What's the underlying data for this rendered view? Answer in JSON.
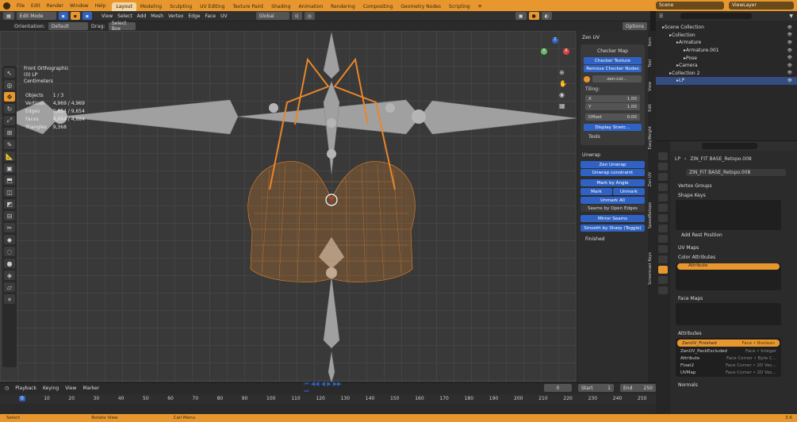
{
  "topbar": {
    "menu": [
      "File",
      "Edit",
      "Render",
      "Window",
      "Help"
    ],
    "workspaces": [
      "Layout",
      "Modeling",
      "Sculpting",
      "UV Editing",
      "Texture Paint",
      "Shading",
      "Animation",
      "Rendering",
      "Compositing",
      "Geometry Nodes",
      "Scripting"
    ],
    "active_workspace": "Layout",
    "scene": "Scene",
    "view_layer": "ViewLayer"
  },
  "viewport_header": {
    "mode": "Edit Mode",
    "menus": [
      "View",
      "Select",
      "Add",
      "Mesh",
      "Vertex",
      "Edge",
      "Face",
      "UV"
    ],
    "transform": "Global",
    "options": "Options",
    "orientation_label": "Orientation:",
    "orientation": "Default",
    "drag_label": "Drag:",
    "drag": "Select Box"
  },
  "viewport_info": {
    "view": "Front Orthographic",
    "object": "(0) LP",
    "units": "Centimeters",
    "stats": [
      [
        "Objects",
        "1 / 3"
      ],
      [
        "Vertices",
        "4,969 / 4,969"
      ],
      [
        "Edges",
        "9,654 / 9,654"
      ],
      [
        "Faces",
        "4,684 / 4,684"
      ],
      [
        "Triangles",
        "9,368"
      ]
    ]
  },
  "gizmo": {
    "x": "X",
    "y": "Y",
    "z": "Z"
  },
  "npanel": {
    "title": "Zen UV",
    "checker_map": "Checker Map",
    "checker_texture": "Checker Texture",
    "remove_checker": "Remove Checker Nodes",
    "texture_name": "zen-col...",
    "tiling": "Tiling:",
    "x_label": "X",
    "x_val": "1.00",
    "y_label": "Y",
    "y_val": "1.00",
    "offset_label": "Offset",
    "offset_val": "0.00",
    "display_stretch": "Display Stretc...",
    "tools": "Tools",
    "unwrap": "Unwrap",
    "zen_unwrap": "Zen Unwrap",
    "unwrap_constraint": "Unwrap constraint",
    "mark_by_angle": "Mark by Angle",
    "mark": "Mark",
    "unmark": "Unmark",
    "unmark_all": "Unmark All",
    "seams_by_open_edges": "Seams by Open Edges",
    "mirror_seams": "Mirror Seams",
    "smooth_by_sharp": "Smooth by Sharp (Toggle)",
    "finished": "Finished"
  },
  "side_tabs": [
    "Item",
    "Tool",
    "View",
    "Edit",
    "EasyWeight",
    "Zen UV",
    "SpeedRetopo",
    "Screencast Keys"
  ],
  "outliner": {
    "items": [
      {
        "name": "Scene Collection",
        "indent": 0
      },
      {
        "name": "Collection",
        "indent": 1
      },
      {
        "name": "Armature",
        "indent": 2
      },
      {
        "name": "Armature.001",
        "indent": 3
      },
      {
        "name": "Pose",
        "indent": 3
      },
      {
        "name": "Camera",
        "indent": 2
      },
      {
        "name": "Collection 2",
        "indent": 1
      },
      {
        "name": "LP",
        "indent": 2
      }
    ]
  },
  "properties": {
    "breadcrumb_obj": "LP",
    "breadcrumb_mesh": "ZIN_FIT BASE_Retopo.008",
    "mesh_name": "ZIN_FIT BASE_Retopo.008",
    "vertex_groups": "Vertex Groups",
    "shape_keys": "Shape Keys",
    "add_rest_position": "Add Rest Position",
    "uv_maps": "UV Maps",
    "color_attributes": "Color Attributes",
    "color_attr_item": "Attribute",
    "face_maps": "Face Maps",
    "attributes": "Attributes",
    "attr_rows": [
      [
        "ZenUV_Finished",
        "Face • Boolean"
      ],
      [
        "ZenUV_PackExcluded",
        "Face • Integer"
      ],
      [
        "Attribute",
        "Face Corner • Byte C..."
      ],
      [
        "Float2",
        "Face Corner • 2D Vec..."
      ],
      [
        "UVMap",
        "Face Corner • 2D Vec..."
      ]
    ],
    "normals": "Normals"
  },
  "timeline": {
    "menus": [
      "Playback",
      "Keying",
      "View",
      "Marker"
    ],
    "current": "0",
    "start_label": "Start",
    "start": "1",
    "end_label": "End",
    "end": "250",
    "ticks": [
      "0",
      "10",
      "20",
      "30",
      "40",
      "50",
      "60",
      "70",
      "80",
      "90",
      "100",
      "110",
      "120",
      "130",
      "140",
      "150",
      "160",
      "170",
      "180",
      "190",
      "200",
      "210",
      "220",
      "230",
      "240",
      "250"
    ]
  },
  "status": {
    "select": "Select",
    "rotate": "Rotate View",
    "menu": "Call Menu",
    "version": "3.6"
  },
  "colors": {
    "accent": "#e8972e",
    "blue": "#2f62c3",
    "mesh": "#e8862a"
  }
}
